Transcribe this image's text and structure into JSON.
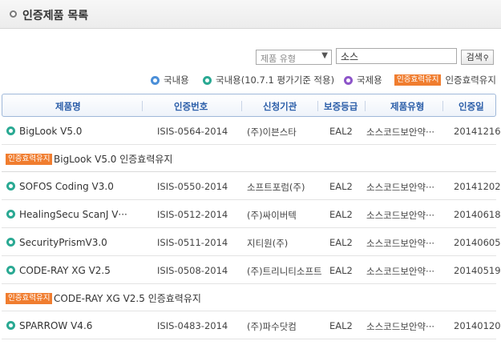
{
  "page": {
    "title": "인증제품 목록"
  },
  "search": {
    "select_value": "제품 유형",
    "query": "소스",
    "button_label": "검색",
    "button_icon": "magnifier-icon"
  },
  "legend": {
    "domestic": "국내용",
    "domestic_old": "국내용(10.7.1 평가기준 적용)",
    "international": "국제용",
    "badge": "인증효력유지",
    "badge_desc": "인증효력유지"
  },
  "table": {
    "headers": {
      "name": "제품명",
      "number": "인증번호",
      "company": "신청기관",
      "grade": "보증등급",
      "type": "제품유형",
      "date": "인증일"
    },
    "rows": [
      {
        "name": "BigLook V5.0",
        "number": "ISIS-0564-2014",
        "company": "(주)이븐스타",
        "grade": "EAL2",
        "type": "소스코드보안약···",
        "date": "20141216"
      },
      {
        "name": "SOFOS Coding V3.0",
        "number": "ISIS-0550-2014",
        "company": "소프트포럼(주)",
        "grade": "EAL2",
        "type": "소스코드보안약···",
        "date": "20141202"
      },
      {
        "name": "HealingSecu ScanJ V···",
        "number": "ISIS-0512-2014",
        "company": "(주)싸이버텍",
        "grade": "EAL2",
        "type": "소스코드보안약···",
        "date": "20140618"
      },
      {
        "name": "SecurityPrismV3.0",
        "number": "ISIS-0511-2014",
        "company": "지티원(주)",
        "grade": "EAL2",
        "type": "소스코드보안약···",
        "date": "20140605"
      },
      {
        "name": "CODE-RAY XG V2.5",
        "number": "ISIS-0508-2014",
        "company": "(주)트리니티소프트",
        "grade": "EAL2",
        "type": "소스코드보안약···",
        "date": "20140519"
      },
      {
        "name": "SPARROW V4.6",
        "number": "ISIS-0483-2014",
        "company": "(주)파수닷컴",
        "grade": "EAL2",
        "type": "소스코드보안약···",
        "date": "20140120"
      }
    ],
    "notes": {
      "biglook": "BigLook V5.0 인증효력유지",
      "coderay": "CODE-RAY XG V2.5 인증효력유지"
    }
  },
  "colors": {
    "header_text": "#2a5da8",
    "badge_bg": "#f07d2f",
    "domestic_dot": "#4b8fd8",
    "domestic_old_dot": "#2aa993",
    "international_dot": "#8d55c9"
  }
}
